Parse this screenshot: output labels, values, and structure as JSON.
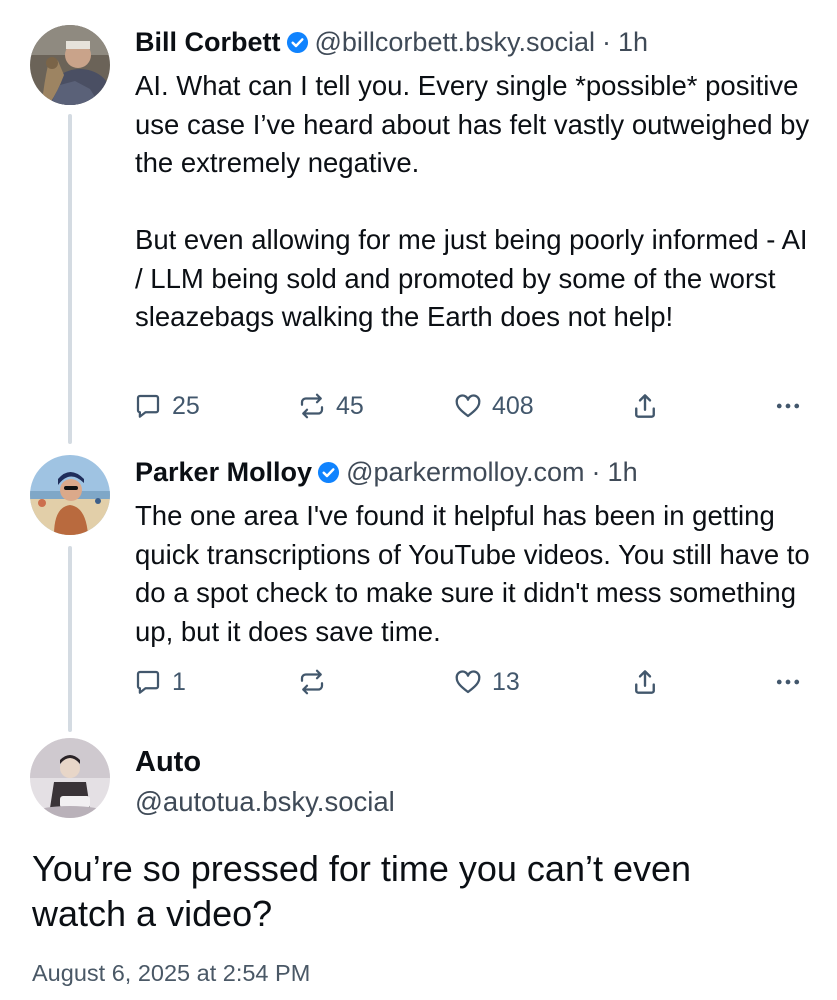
{
  "thread": [
    {
      "author_name": "Bill Corbett",
      "verified_icon": "verified-check-icon",
      "handle": "@billcorbett.bsky.social",
      "separator": "·",
      "time": "1h",
      "text": "AI. What can I tell you. Every single *possible* positive use case I’ve heard about has felt vastly outweighed by the extremely negative.\n\nBut even allowing for me just being poorly informed - AI / LLM being sold and promoted by some of the worst sleazebags walking the Earth does not help!",
      "actions": {
        "replies": "25",
        "reposts": "45",
        "likes": "408"
      }
    },
    {
      "author_name": "Parker Molloy",
      "verified_icon": "verified-check-icon",
      "handle": "@parkermolloy.com",
      "separator": "·",
      "time": "1h",
      "text": "The one area I've found it helpful has been in getting quick transcriptions of YouTube videos. You still have to do a spot check to make sure it didn't mess something up, but it does save time.",
      "actions": {
        "replies": "1",
        "reposts": "",
        "likes": "13"
      }
    }
  ],
  "main_post": {
    "author_name": "Auto",
    "handle": "@autotua.bsky.social",
    "text": "You’re so pressed for time you can’t even watch a video?",
    "timestamp": "August 6, 2025 at 2:54 PM"
  },
  "colors": {
    "verified": "#1083fe",
    "thread_line": "#d4dbe2",
    "muted_text": "#3f4a57",
    "action_icon": "#42576c"
  }
}
